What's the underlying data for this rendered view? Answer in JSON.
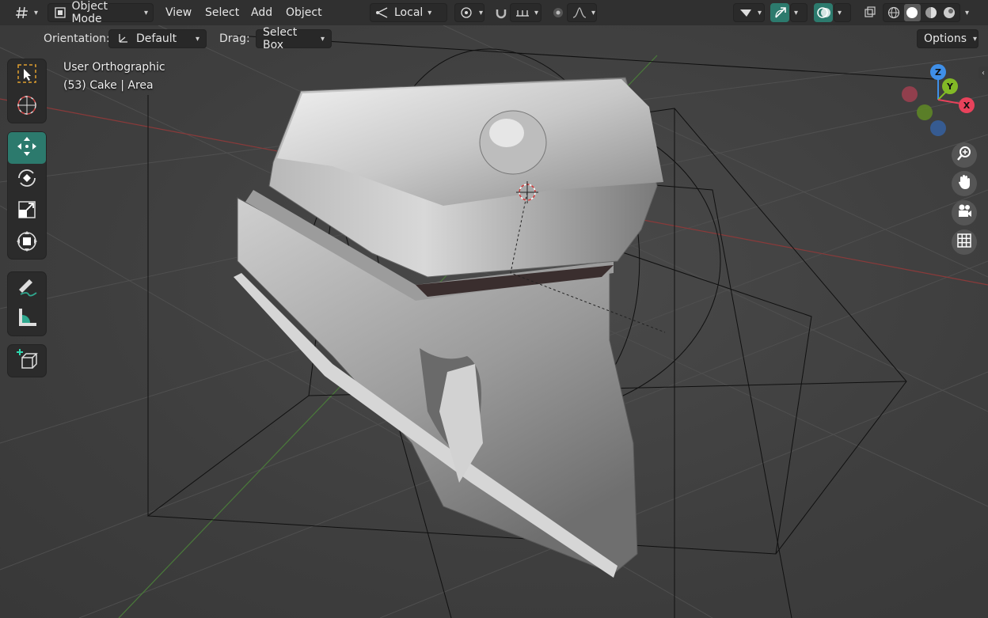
{
  "header": {
    "mode_label": "Object Mode",
    "menus": [
      "View",
      "Select",
      "Add",
      "Object"
    ],
    "transform_orientation": "Local"
  },
  "tool_settings": {
    "orientation_label": "Orientation:",
    "orientation_value": "Default",
    "drag_label": "Drag:",
    "drag_value": "Select Box",
    "options_label": "Options"
  },
  "viewport": {
    "view_name": "User Orthographic",
    "object_info": "(53) Cake | Area"
  },
  "gizmo": {
    "z_label": "Z",
    "y_label": "Y",
    "x_label": "X",
    "colors": {
      "x": "#e8425b",
      "y": "#82b926",
      "z": "#3f8fe8"
    }
  },
  "colors": {
    "accent": "#2c7a6d",
    "x_axis_line": "#8a3a3a",
    "y_axis_line": "#4a7a3a"
  }
}
